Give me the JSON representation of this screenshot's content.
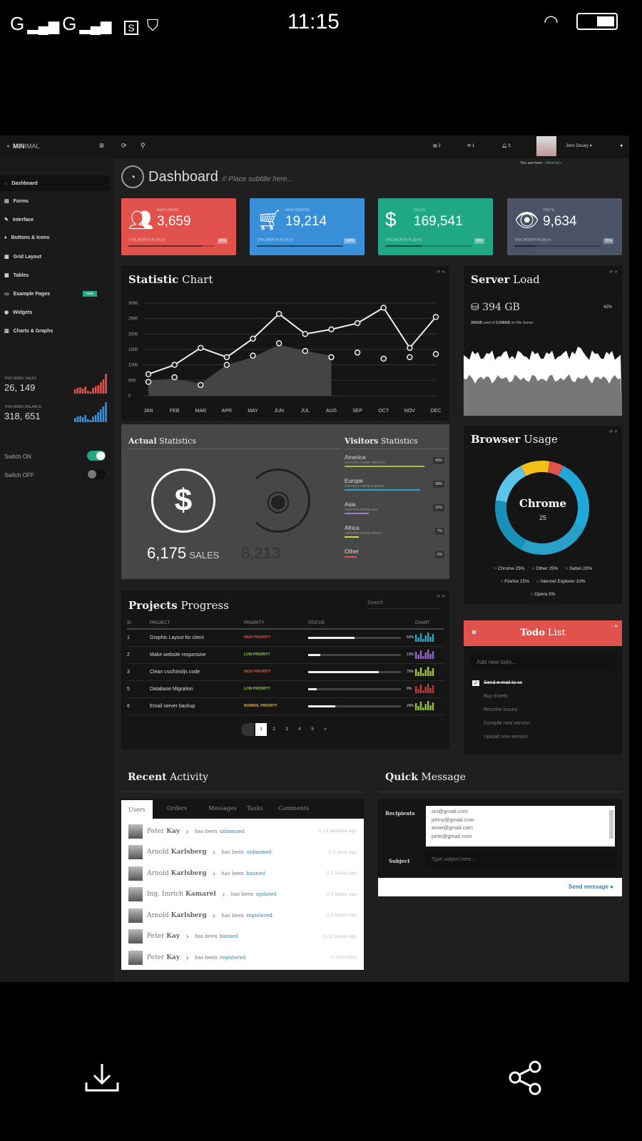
{
  "status_bar": {
    "time": "11:15",
    "carrier1": "G",
    "carrier2": "G",
    "sim_icon": "S"
  },
  "app": {
    "logo_bold": "MIN",
    "logo_rest": "IMAL",
    "user": "John Douey",
    "badges": [
      "2",
      "1",
      "3"
    ],
    "breadcrumb_prefix": "You are here",
    "breadcrumb_link": "Minimal"
  },
  "page": {
    "title": "Dashboard",
    "subtitle": "// Place subtitle here..."
  },
  "sidebar": {
    "items": [
      {
        "label": "Dashboard",
        "icon": "home-icon"
      },
      {
        "label": "Forms",
        "icon": "list-icon"
      },
      {
        "label": "Interface",
        "icon": "pencil-icon"
      },
      {
        "label": "Buttons & Icons",
        "icon": "drop-icon"
      },
      {
        "label": "Grid Layout",
        "icon": "grid-icon"
      },
      {
        "label": "Tables",
        "icon": "table-icon"
      },
      {
        "label": "Example Pages",
        "icon": "monitor-icon",
        "badge": "new"
      },
      {
        "label": "Widgets",
        "icon": "circle-icon"
      },
      {
        "label": "Charts & Graphs",
        "icon": "chart-icon"
      }
    ],
    "week_sales_label": "THIS WEEK SALES",
    "week_sales": "26, 149",
    "week_balance_label": "THIS WEEK BALANCE",
    "week_balance": "318, 651",
    "switch_on": "Switch ON",
    "switch_off": "Switch OFF",
    "switch_on_state": true,
    "switch_off_state": false
  },
  "cards": [
    {
      "label": "NEW USERS",
      "value": "3,659",
      "plan": "THIS MONTH PLAN %",
      "pct": "85%",
      "fill": 85,
      "color": "#e0524b"
    },
    {
      "label": "NEW ORDERS",
      "value": "19,214",
      "plan": "THIS MONTH PLAN %",
      "pct": "100%",
      "fill": 100,
      "color": "#3a8fd9"
    },
    {
      "label": "SALES",
      "value": "169,541",
      "plan": "THIS MONTH PLAN %",
      "pct": "42%",
      "fill": 42,
      "color": "#1fa883"
    },
    {
      "label": "VISITS",
      "value": "9,634",
      "plan": "THIS MONTH PLAN %",
      "pct": "25%",
      "fill": 25,
      "color": "#4a5466"
    }
  ],
  "statistic": {
    "title_bold": "Statistic",
    "title_rest": "Chart"
  },
  "chart_data": {
    "type": "line",
    "categories": [
      "JAN",
      "FEB",
      "MAR",
      "APR",
      "MAY",
      "JUN",
      "JUL",
      "AUG",
      "SEP",
      "OCT",
      "NOV",
      "DEC"
    ],
    "yticks": [
      "0",
      "500",
      "1000",
      "1500",
      "2000",
      "2500",
      "3000"
    ],
    "ylim": [
      0,
      3000
    ],
    "grid": true,
    "series": [
      {
        "type": "line",
        "values": [
          700,
          1000,
          1550,
          1250,
          1850,
          2650,
          2000,
          2150,
          2350,
          2850,
          1550,
          2550
        ]
      },
      {
        "type": "scatter",
        "values": [
          450,
          600,
          350,
          1000,
          1300,
          1700,
          1450,
          1250,
          1400,
          1200,
          1250,
          1350
        ]
      },
      {
        "type": "area",
        "values": [
          500,
          550,
          400,
          1000,
          1250,
          1650,
          1450,
          1300
        ]
      }
    ]
  },
  "server": {
    "title_bold": "Server",
    "title_rest": "Load",
    "value": "394 GB",
    "pct": "42%",
    "used": "394GB",
    "total": "2,048GB",
    "note_mid": "used of",
    "note_end": "on File Server"
  },
  "actual": {
    "title_bold": "Actual",
    "title_rest": "Statistics",
    "sales": "6,175",
    "sales_label": "SALES",
    "visits": "8,213",
    "visits_label": "VISITS"
  },
  "visitors": {
    "title_bold": "Visitors",
    "title_rest": "Statistics",
    "rows": [
      {
        "name": "America",
        "sub": "VISITORS FROM AMERICA",
        "pct": "40%",
        "v": 40,
        "color": "#a6c23a"
      },
      {
        "name": "Europe",
        "sub": "VISITORS FROM EUROPE",
        "pct": "38%",
        "v": 38,
        "color": "#2aa6c4"
      },
      {
        "name": "Asia",
        "sub": "VISITORS FROM ASIA",
        "pct": "12%",
        "v": 12,
        "color": "#9a7fd1"
      },
      {
        "name": "Africa",
        "sub": "VISITORS FROM AFRICA",
        "pct": "7%",
        "v": 7,
        "color": "#d9d23a"
      },
      {
        "name": "Other",
        "sub": "",
        "pct": "6%",
        "v": 6,
        "color": "#e0524b"
      }
    ]
  },
  "browser": {
    "title_bold": "Browser",
    "title_rest": "Usage",
    "center_label": "Chrome",
    "center_value": "25",
    "slices": [
      {
        "name": "Chrome",
        "value": 25,
        "label": "Chrome 25%",
        "color": "#1fa8d9"
      },
      {
        "name": "Other",
        "value": 25,
        "label": "Other 25%",
        "color": "#2a9fc7"
      },
      {
        "name": "Safari",
        "value": 20,
        "label": "Safari 20%",
        "color": "#1a8fb8"
      },
      {
        "name": "Firefox",
        "value": 15,
        "label": "Firefox 15%",
        "color": "#5cc4e8"
      },
      {
        "name": "Internet Explorer",
        "value": 10,
        "label": "Internet Explorer 10%",
        "color": "#f2c019"
      },
      {
        "name": "Opera",
        "value": 5,
        "label": "Opera 5%",
        "color": "#e0524b"
      }
    ]
  },
  "projects": {
    "title_bold": "Projects",
    "title_rest": "Progress",
    "search_placeholder": "Search",
    "headers": [
      "ID",
      "PROJECT",
      "PRIORITY",
      "STATUS",
      "CHART"
    ],
    "rows": [
      {
        "id": "1",
        "name": "Graphic Layout for client",
        "priority": "HIGH PRIORITY",
        "pcolor": "#e0524b",
        "pct": "50%",
        "v": 50,
        "ccolor": "#2aa6c4"
      },
      {
        "id": "2",
        "name": "Make website responsive",
        "priority": "LOW PRIORITY",
        "pcolor": "#8cc43a",
        "pct": "13%",
        "v": 13,
        "ccolor": "#9a5fd1"
      },
      {
        "id": "3",
        "name": "Clean css/html/js code",
        "priority": "HIGH PRIORITY",
        "pcolor": "#e0524b",
        "pct": "76%",
        "v": 76,
        "ccolor": "#a6c23a"
      },
      {
        "id": "5",
        "name": "Database Migration",
        "priority": "LOW PRIORITY",
        "pcolor": "#8cc43a",
        "pct": "9%",
        "v": 9,
        "ccolor": "#c43a3a"
      },
      {
        "id": "6",
        "name": "Email server backup",
        "priority": "NORMAL PRIORITY",
        "pcolor": "#e0b03a",
        "pct": "29%",
        "v": 29,
        "ccolor": "#8cc43a"
      }
    ],
    "pages": [
      "1",
      "2",
      "3",
      "4",
      "5",
      "»"
    ]
  },
  "todo": {
    "title_bold": "Todo",
    "title_rest": "List",
    "placeholder": "Add new todo...",
    "items": [
      {
        "text": "Send e-mail to xx",
        "done": true
      },
      {
        "text": "Buy tickets",
        "done": false
      },
      {
        "text": "Resolve issues",
        "done": false
      },
      {
        "text": "Compile new version",
        "done": false
      },
      {
        "text": "Upload new version",
        "done": false
      }
    ]
  },
  "activity": {
    "title_bold": "Recent",
    "title_rest": "Activity",
    "tabs": [
      "Users",
      "Orders",
      "Messages",
      "Tasks",
      "Comments"
    ],
    "rows": [
      {
        "first": "Peter",
        "last": "Kay",
        "verb": "has been",
        "action": "unbanned",
        "time": "12 minutes ago"
      },
      {
        "first": "Arnold",
        "last": "Karlsberg",
        "verb": "has been",
        "action": "unbanned",
        "time": "1 hour ago"
      },
      {
        "first": "Arnold",
        "last": "Karlsberg",
        "verb": "has been",
        "action": "banned",
        "time": "2 hours ago"
      },
      {
        "first": "Ing. Imrich",
        "last": "Kamarel",
        "verb": "has been",
        "action": "updated",
        "time": "4 hours ago"
      },
      {
        "first": "Arnold",
        "last": "Karlsberg",
        "verb": "has been",
        "action": "registered",
        "time": "6 hours ago"
      },
      {
        "first": "Peter",
        "last": "Kay",
        "verb": "has been",
        "action": "banned",
        "time": "12 hours ago"
      },
      {
        "first": "Peter",
        "last": "Kay",
        "verb": "has been",
        "action": "registered",
        "time": "yesterday"
      }
    ]
  },
  "message": {
    "title_bold": "Quick",
    "title_rest": "Message",
    "recipients_label": "Recipients",
    "recipients": [
      "sci@gmail.com",
      "johny@gmail.com",
      "amie@gmail.com",
      "pete@gmail.com"
    ],
    "subject_label": "Subject",
    "subject_placeholder": "Type subject here...",
    "send": "Send message"
  }
}
